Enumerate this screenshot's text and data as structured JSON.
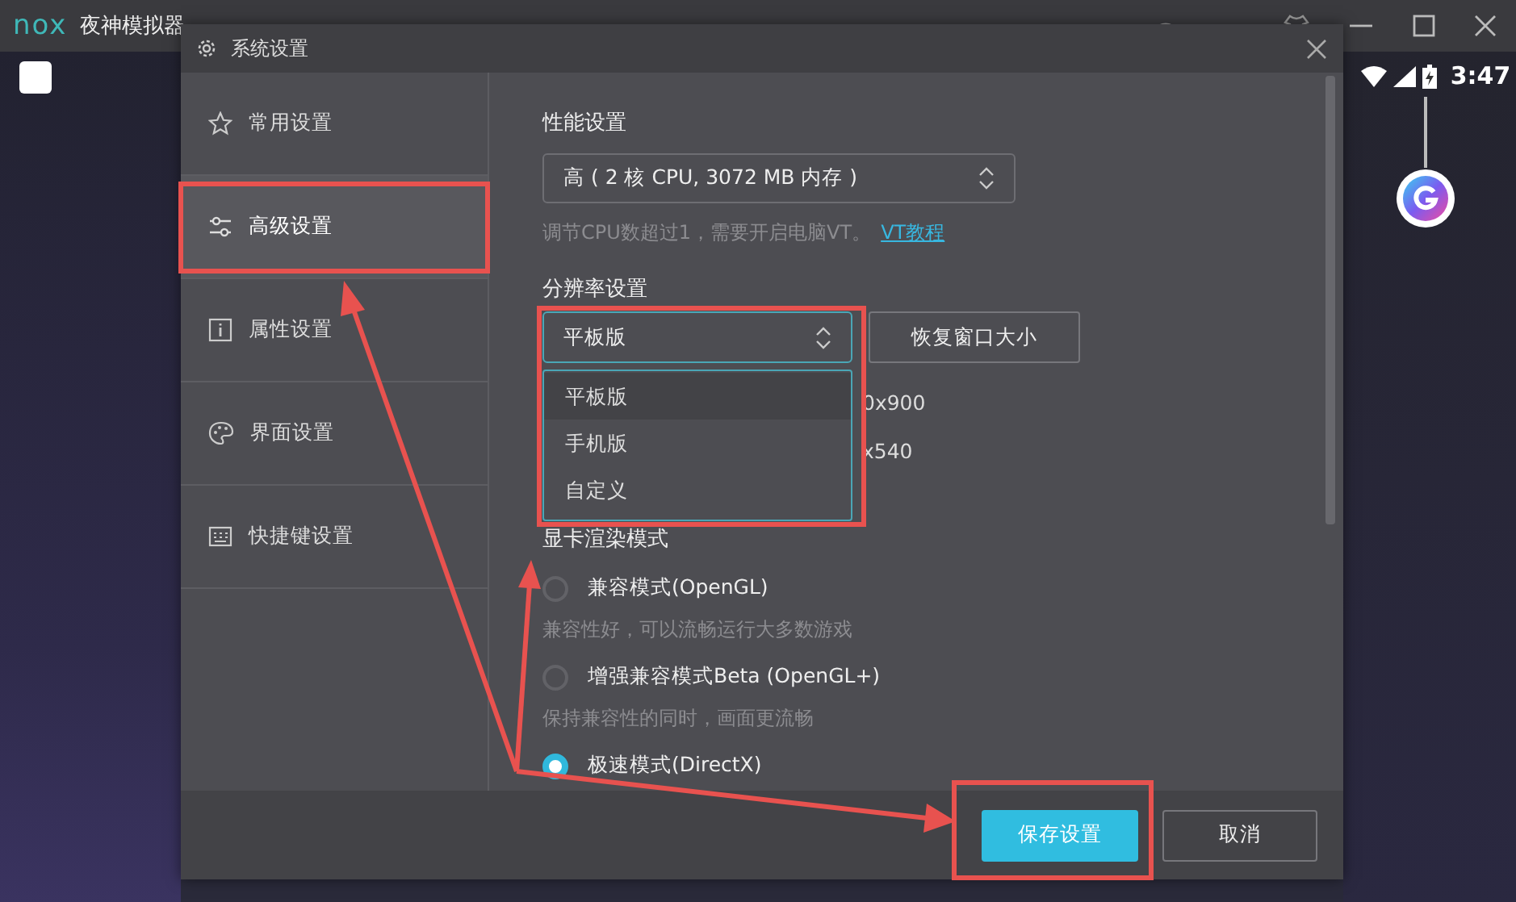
{
  "app": {
    "logo": "nox",
    "title": "夜神模拟器",
    "time": "3:47"
  },
  "dialog": {
    "title": "系统设置",
    "sidebar": [
      {
        "label": "常用设置",
        "kind": "star",
        "selected": false
      },
      {
        "label": "高级设置",
        "kind": "sliders",
        "selected": true
      },
      {
        "label": "属性设置",
        "kind": "info",
        "selected": false
      },
      {
        "label": "界面设置",
        "kind": "palette",
        "selected": false
      },
      {
        "label": "快捷键设置",
        "kind": "keyboard",
        "selected": false
      }
    ],
    "performance": {
      "heading": "性能设置",
      "value": "高 ( 2 核 CPU, 3072 MB 内存 )",
      "hint": "调节CPU数超过1，需要开启电脑VT。",
      "link": "VT教程"
    },
    "resolution": {
      "heading": "分辨率设置",
      "value": "平板版",
      "expanded": true,
      "options": [
        {
          "label": "平板版",
          "selected": true
        },
        {
          "label": "手机版",
          "selected": false
        },
        {
          "label": "自定义",
          "selected": false
        }
      ],
      "reset_button": "恢复窗口大小",
      "covered_texts": [
        "0x900",
        "x540"
      ]
    },
    "render": {
      "heading": "显卡渲染模式",
      "options": [
        {
          "label": "兼容模式(OpenGL)",
          "hint": "兼容性好，可以流畅运行大多数游戏",
          "selected": false
        },
        {
          "label": "增强兼容模式Beta (OpenGL+)",
          "hint": "保持兼容性的同时，画面更流畅",
          "selected": false
        },
        {
          "label": "极速模式(DirectX)",
          "selected": true
        }
      ]
    },
    "buttons": [
      {
        "label": "保存设置",
        "kind": "primary"
      },
      {
        "label": "取消",
        "kind": "secondary"
      }
    ]
  }
}
